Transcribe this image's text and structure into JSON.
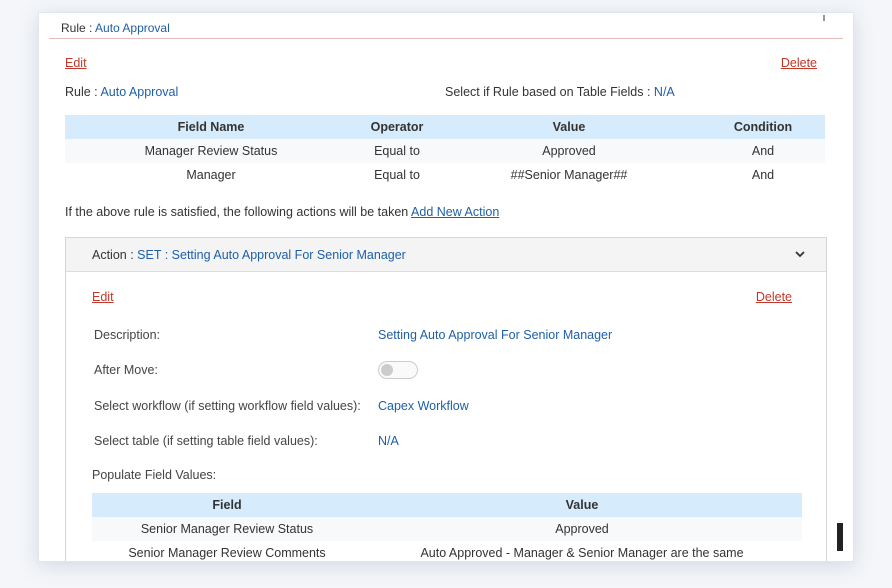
{
  "topbar": {
    "prefix": "Rule : ",
    "name": "Auto Approval"
  },
  "rule": {
    "edit": "Edit",
    "delete": "Delete",
    "rule_prefix": "Rule : ",
    "rule_name": "Auto Approval",
    "select_prefix": "Select if Rule based on Table Fields : ",
    "select_value": "N/A",
    "table": {
      "headers": [
        "Field Name",
        "Operator",
        "Value",
        "Condition"
      ],
      "rows": [
        [
          "Manager Review Status",
          "Equal to",
          "Approved",
          "And"
        ],
        [
          "Manager",
          "Equal to",
          "##Senior Manager##",
          "And"
        ]
      ]
    },
    "satisfied_text": "If the above rule is satisfied, the following actions will be taken",
    "add_action": "Add New Action"
  },
  "action": {
    "header_prefix": "Action : ",
    "header_value": "SET : Setting Auto Approval For Senior Manager",
    "edit": "Edit",
    "delete": "Delete",
    "description_label": "Description:",
    "description_value": "Setting Auto Approval For Senior Manager",
    "after_move_label": "After Move:",
    "after_move_on": false,
    "workflow_label": "Select workflow (if setting workflow field values):",
    "workflow_value": "Capex Workflow",
    "table_label": "Select table (if setting table field values):",
    "table_value": "N/A",
    "populate_label": "Populate Field Values:",
    "fields_table": {
      "headers": [
        "Field",
        "Value"
      ],
      "rows": [
        [
          "Senior Manager Review Status",
          "Approved"
        ],
        [
          "Senior Manager Review Comments",
          "Auto Approved - Manager & Senior Manager are the same"
        ]
      ]
    }
  }
}
